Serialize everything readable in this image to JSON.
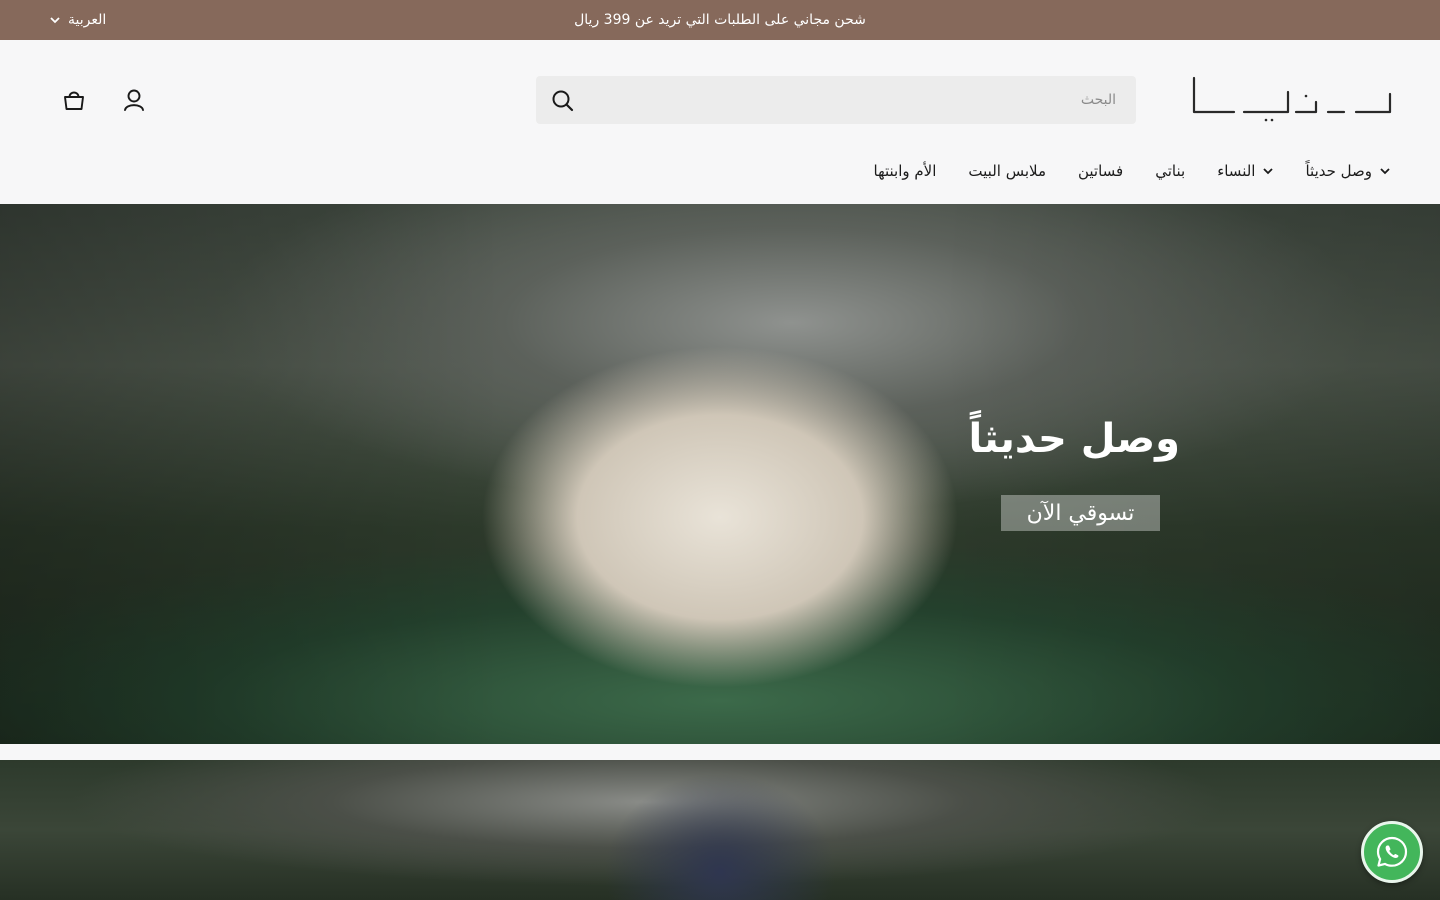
{
  "topbar": {
    "announcement": "شحن مجاني على الطلبات التي تريد عن 399 ريال",
    "language_label": "العربية",
    "background": "#86695b"
  },
  "header": {
    "logo_icon": "brand-logo",
    "search": {
      "placeholder": "البحث"
    },
    "icons": {
      "search": "search-icon",
      "account": "user-icon",
      "cart": "shopping-bag-icon"
    }
  },
  "nav": {
    "items": [
      {
        "label": "وصل حديثاً",
        "has_dropdown": true
      },
      {
        "label": "النساء",
        "has_dropdown": true
      },
      {
        "label": "بناتي",
        "has_dropdown": false
      },
      {
        "label": "فساتين",
        "has_dropdown": false
      },
      {
        "label": "ملابس البيت",
        "has_dropdown": false
      },
      {
        "label": "الأم وابنتها",
        "has_dropdown": false
      }
    ]
  },
  "hero": {
    "title": "وصل حديثاً",
    "cta_label": "تسوقي الآن"
  },
  "floating": {
    "whatsapp_icon": "whatsapp-icon",
    "color": "#43b65b"
  }
}
